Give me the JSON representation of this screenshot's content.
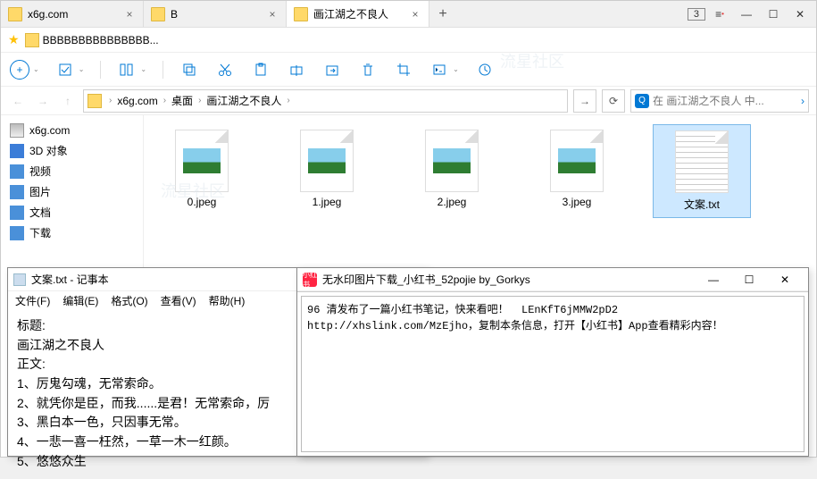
{
  "tabs": [
    {
      "label": "x6g.com"
    },
    {
      "label": "B"
    },
    {
      "label": "画江湖之不良人"
    }
  ],
  "tab_badge": "3",
  "bookmark": {
    "label": "BBBBBBBBBBBBBBB..."
  },
  "breadcrumbs": [
    "x6g.com",
    "桌面",
    "画江湖之不良人"
  ],
  "search": {
    "placeholder": "在 画江湖之不良人 中..."
  },
  "sidebar": [
    {
      "label": "x6g.com",
      "icon": "disk"
    },
    {
      "label": "3D 对象",
      "icon": "cube"
    },
    {
      "label": "视频",
      "icon": "video"
    },
    {
      "label": "图片",
      "icon": "pic"
    },
    {
      "label": "文档",
      "icon": "doc"
    },
    {
      "label": "下载",
      "icon": "dl"
    }
  ],
  "files": [
    {
      "name": "0.jpeg",
      "type": "img"
    },
    {
      "name": "1.jpeg",
      "type": "img"
    },
    {
      "name": "2.jpeg",
      "type": "img"
    },
    {
      "name": "3.jpeg",
      "type": "img"
    },
    {
      "name": "文案.txt",
      "type": "txt",
      "selected": true
    }
  ],
  "notepad": {
    "title": "文案.txt - 记事本",
    "menu": [
      "文件(F)",
      "编辑(E)",
      "格式(O)",
      "查看(V)",
      "帮助(H)"
    ],
    "lines": [
      "标题:",
      "画江湖之不良人",
      "正文:",
      "1、厉鬼勾魂，无常索命。",
      "2、就凭你是臣，而我......是君！无常索命，厉",
      "3、黑白本一色，只因事无常。",
      "4、一悲一喜一枉然，一草一木一红颜。",
      "5、悠悠众生"
    ]
  },
  "downloader": {
    "title": "无水印图片下载_小红书_52pojie  by_Gorkys",
    "text": "96 清发布了一篇小红书笔记，快来看吧！  LEnKfT6jMMW2pD2  http://xhslink.com/MzEjho，复制本条信息，打开【小红书】App查看精彩内容！\n"
  },
  "watermark": "流星社区"
}
